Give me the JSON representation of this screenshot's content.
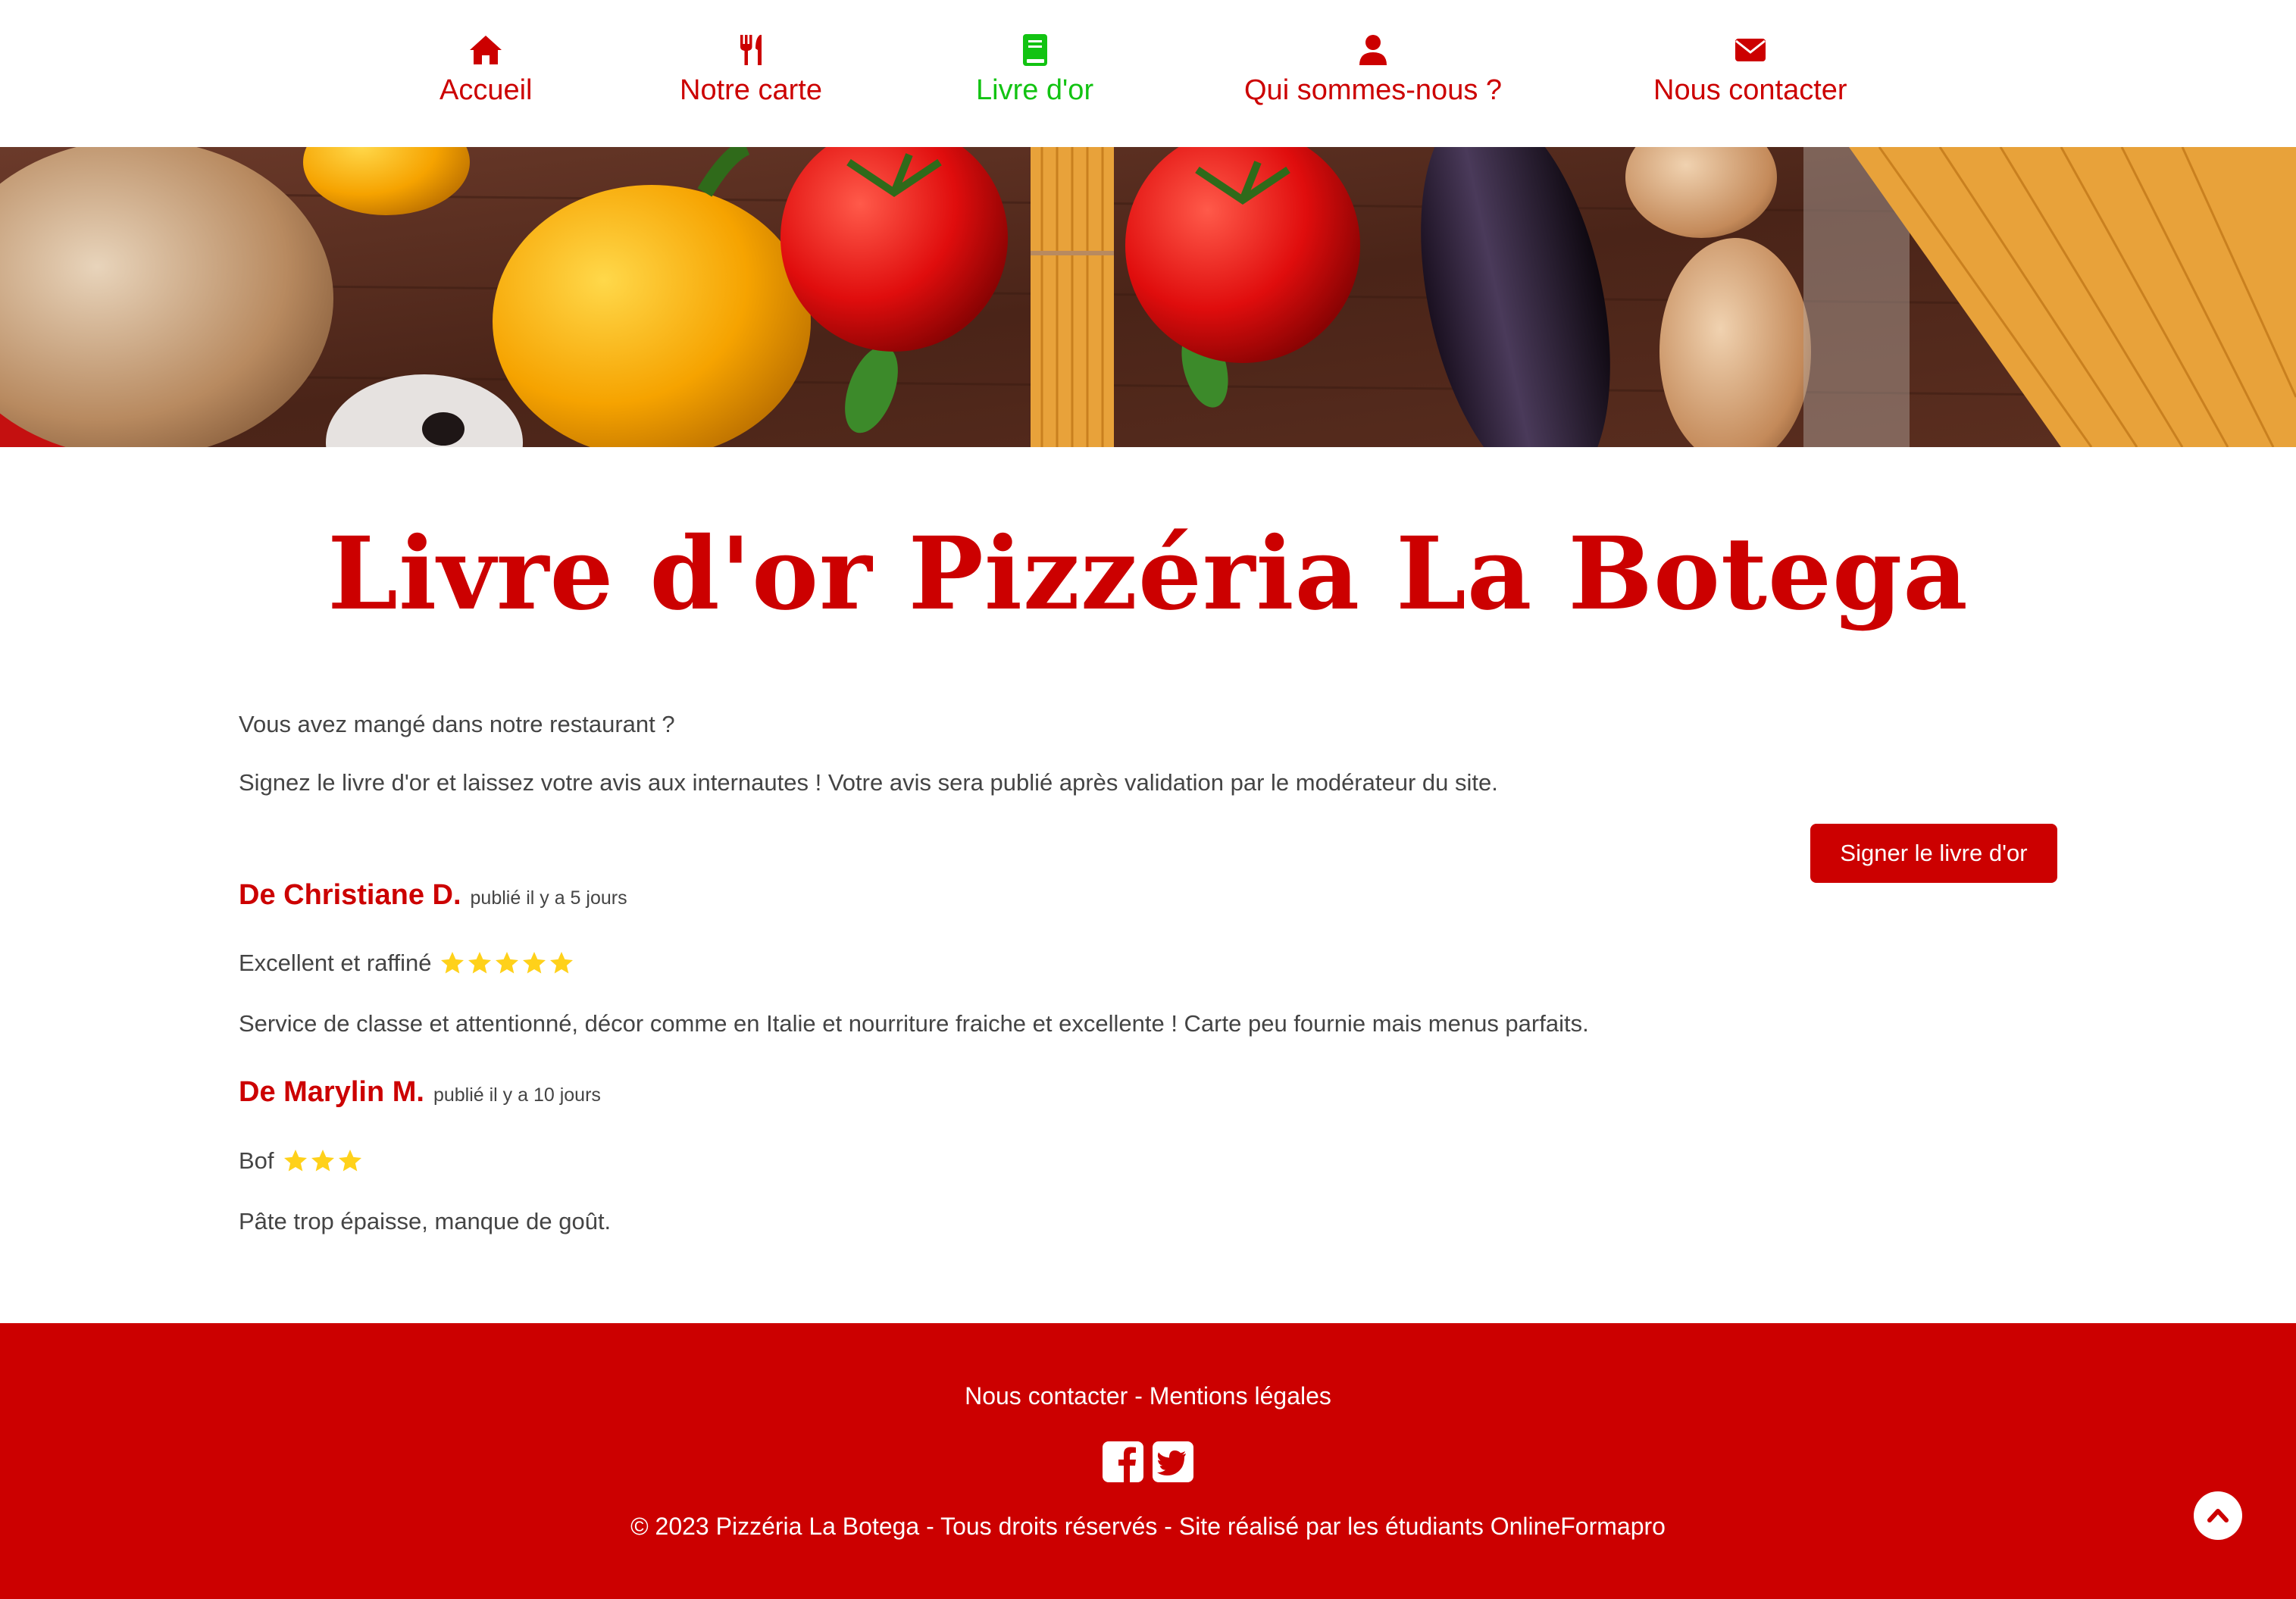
{
  "nav": {
    "items": [
      {
        "label": "Accueil",
        "icon": "home-icon"
      },
      {
        "label": "Notre carte",
        "icon": "utensils-icon"
      },
      {
        "label": "Livre d'or",
        "icon": "book-icon"
      },
      {
        "label": "Qui sommes-nous ?",
        "icon": "user-icon"
      },
      {
        "label": "Nous contacter",
        "icon": "envelope-icon"
      }
    ],
    "active": "Livre d'or",
    "color": "#cc0000",
    "active_color": "#12c312"
  },
  "hero": {
    "description_icon": "vegetables-banner-image"
  },
  "main": {
    "title": "Livre d'or Pizzéria La Botega",
    "intro1": "Vous avez mangé dans notre restaurant ?",
    "intro2": "Signez le livre d'or et laissez votre avis aux internautes ! Votre avis sera publié après validation par le modérateur du site.",
    "sign_button": "Signer le livre d'or"
  },
  "reviews": [
    {
      "author": "De Christiane D.",
      "date": "publié il y a 5 jours",
      "title": "Excellent et raffiné",
      "rating": 5,
      "body": "Service de classe et attentionné, décor comme en Italie et nourriture fraiche et excellente ! Carte peu fournie mais menus parfaits."
    },
    {
      "author": "De Marylin M.",
      "date": "publié il y a 10 jours",
      "title": "Bof",
      "rating": 3,
      "body": "Pâte trop épaisse, manque de goût."
    }
  ],
  "footer": {
    "contact_link": "Nous contacter",
    "separator": " - ",
    "legal_link": "Mentions légales",
    "social": [
      "facebook-icon",
      "twitter-icon"
    ],
    "copyright": "© 2023 Pizzéria La Botega - Tous droits réservés - Site réalisé par les étudiants OnlineFormapro",
    "color": "#cc0000"
  },
  "colors": {
    "brand_red": "#cc0000",
    "star_yellow": "#ffd11a",
    "text": "#444444"
  }
}
